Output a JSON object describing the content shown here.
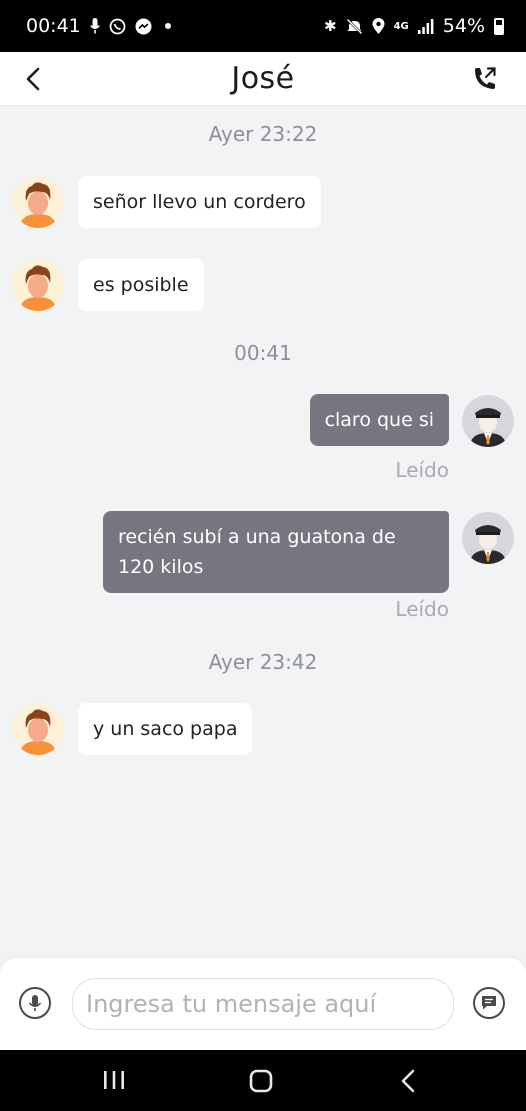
{
  "status_bar": {
    "time": "00:41",
    "battery": "54%",
    "network": "4G"
  },
  "header": {
    "contact_name": "José",
    "back_icon": "chevron-left-icon",
    "call_icon": "phone-outgoing-icon"
  },
  "messages": [
    {
      "type": "timestamp",
      "text": "Ayer 23:22"
    },
    {
      "type": "incoming",
      "text": "señor llevo un cordero"
    },
    {
      "type": "incoming",
      "text": "es posible"
    },
    {
      "type": "timestamp",
      "text": "00:41"
    },
    {
      "type": "outgoing",
      "text": "claro que si",
      "status": "Leído"
    },
    {
      "type": "outgoing",
      "text": "recién subí a una guatona de 120 kilos",
      "status": "Leído"
    },
    {
      "type": "timestamp",
      "text": "Ayer 23:42"
    },
    {
      "type": "incoming",
      "text": "y un saco papa"
    }
  ],
  "composer": {
    "placeholder": "Ingresa tu mensaje aquí",
    "value": "",
    "mic_icon": "microphone-icon",
    "send_icon": "quick-reply-icon"
  },
  "colors": {
    "outgoing_bubble": "#75767f",
    "incoming_bubble": "#ffffff",
    "chat_background": "#f2f3f5",
    "passenger_avatar": "#f6913a",
    "driver_avatar_bg": "#d6d7da"
  }
}
